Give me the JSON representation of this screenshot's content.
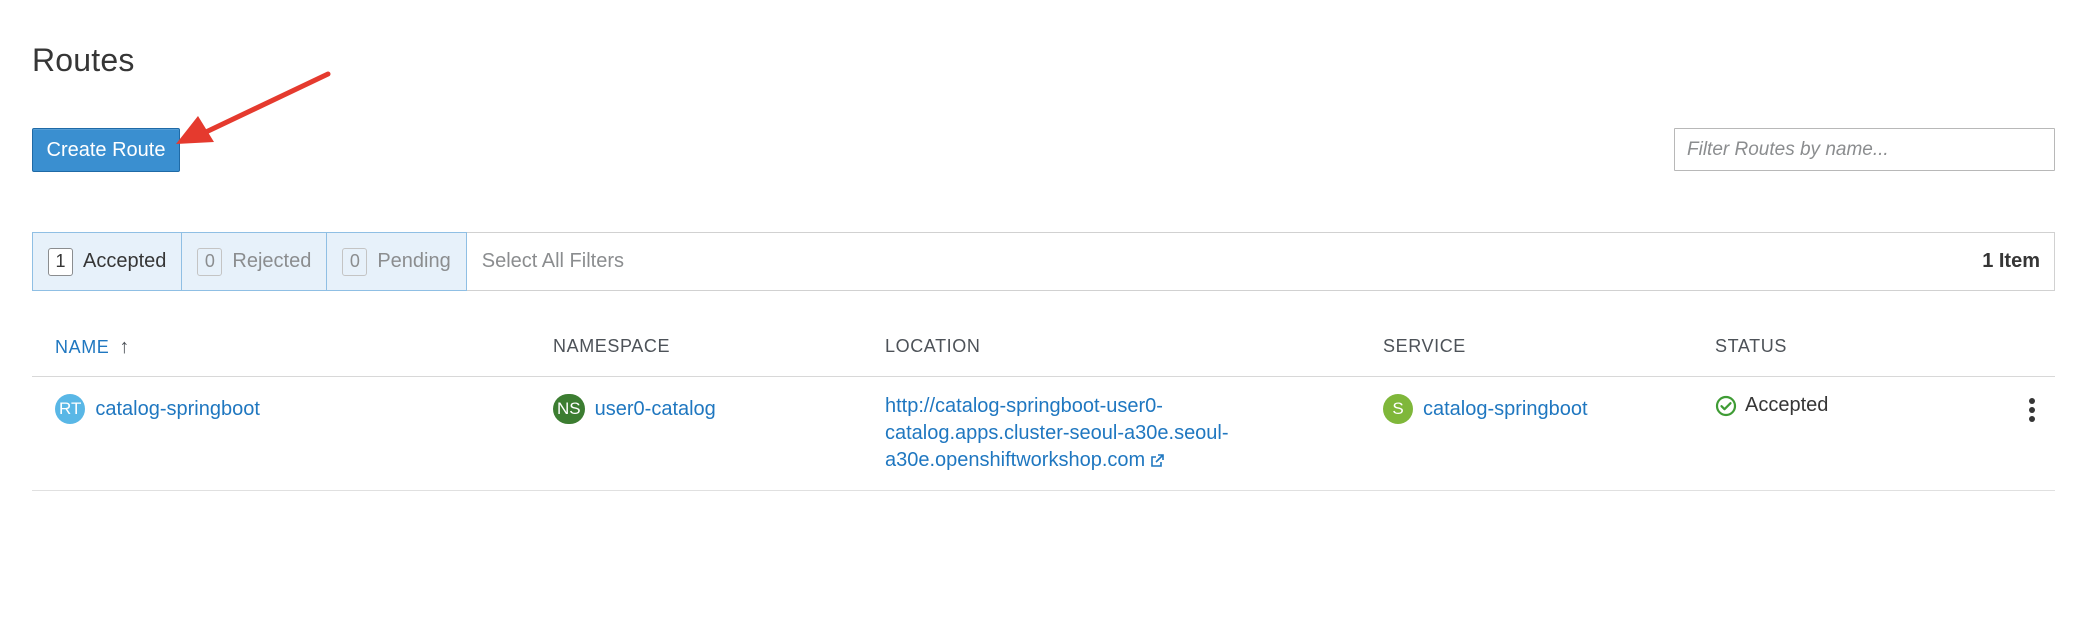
{
  "page": {
    "title": "Routes"
  },
  "toolbar": {
    "create_label": "Create Route",
    "filter_placeholder": "Filter Routes by name..."
  },
  "filters": {
    "accepted": {
      "count": "1",
      "label": "Accepted"
    },
    "rejected": {
      "count": "0",
      "label": "Rejected"
    },
    "pending": {
      "count": "0",
      "label": "Pending"
    },
    "select_all": "Select All Filters",
    "item_count": "1 Item"
  },
  "table": {
    "headers": {
      "name": "NAME",
      "namespace": "NAMESPACE",
      "location": "LOCATION",
      "service": "SERVICE",
      "status": "STATUS"
    },
    "sorted_column": "name",
    "sort_direction": "ascending",
    "rows": [
      {
        "name_badge": "RT",
        "name": "catalog-springboot",
        "namespace_badge": "NS",
        "namespace": "user0-catalog",
        "location_line1": "http://catalog-springboot-user0-",
        "location_line2": "catalog.apps.cluster-seoul-a30e.seoul-",
        "location_line3": "a30e.openshiftworkshop.com",
        "service_badge": "S",
        "service": "catalog-springboot",
        "status": "Accepted"
      }
    ]
  },
  "colors": {
    "primary_button": "#3a8fd0",
    "link": "#1f77c0",
    "badge_route": "#59b7e6",
    "badge_namespace": "#3c7d31",
    "badge_service": "#7fb73a",
    "status_ok": "#3f9c35",
    "annotation_arrow": "#e53a2e"
  }
}
